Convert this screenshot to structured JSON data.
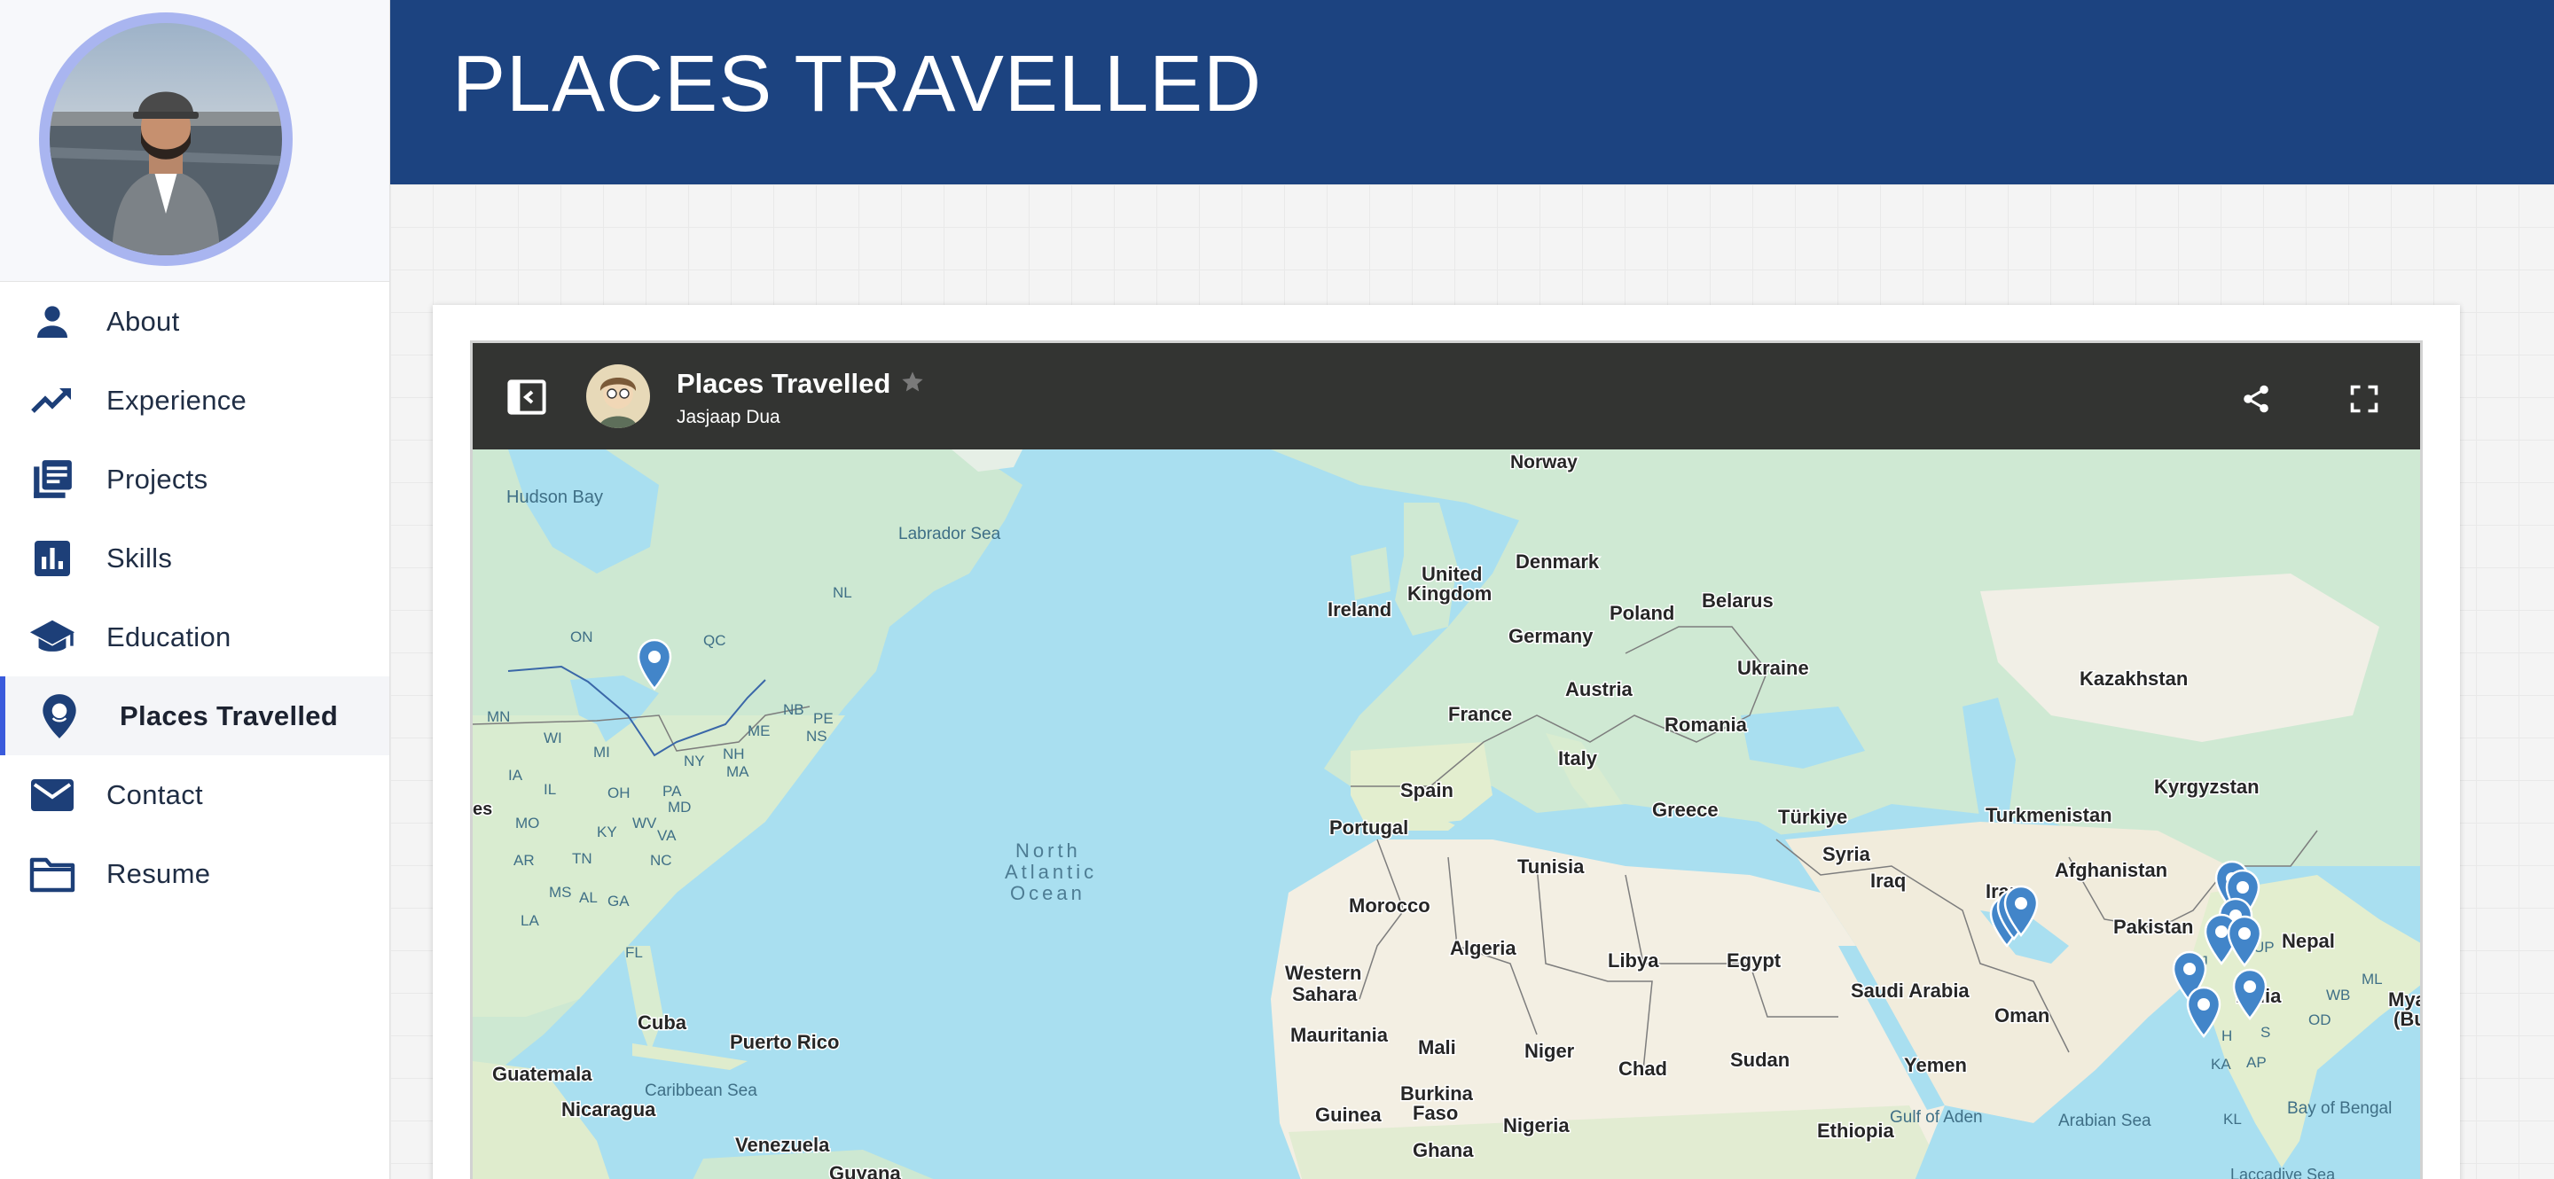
{
  "sidebar": {
    "items": [
      {
        "label": "About",
        "icon": "person-icon"
      },
      {
        "label": "Experience",
        "icon": "trending-up-icon"
      },
      {
        "label": "Projects",
        "icon": "article-icon"
      },
      {
        "label": "Skills",
        "icon": "bar-chart-icon"
      },
      {
        "label": "Education",
        "icon": "school-icon"
      },
      {
        "label": "Places Travelled",
        "icon": "map-pin-icon",
        "active": true
      },
      {
        "label": "Contact",
        "icon": "mail-icon"
      },
      {
        "label": "Resume",
        "icon": "folder-icon"
      }
    ]
  },
  "header": {
    "title": "PLACES TRAVELLED"
  },
  "map": {
    "title": "Places Travelled",
    "owner": "Jasjaap Dua",
    "labels": {
      "hudson_bay": "Hudson Bay",
      "labrador_sea": "Labrador Sea",
      "nl": "NL",
      "on": "ON",
      "qc": "QC",
      "mn": "MN",
      "wi": "WI",
      "mi": "MI",
      "me": "ME",
      "nb": "NB",
      "pe": "PE",
      "ns": "NS",
      "ia": "IA",
      "il": "IL",
      "oh": "OH",
      "ny": "NY",
      "nh": "NH",
      "ma": "MA",
      "pa": "PA",
      "md": "MD",
      "mo": "MO",
      "wv": "WV",
      "ky": "KY",
      "va": "VA",
      "ar": "AR",
      "tn": "TN",
      "nc": "NC",
      "ms": "MS",
      "al": "AL",
      "ga": "GA",
      "la": "LA",
      "fl": "FL",
      "es": "es",
      "north_atlantic": "North",
      "north_atlantic2": "Atlantic",
      "north_atlantic3": "Ocean",
      "norway": "Norway",
      "united": "United",
      "kingdom": "Kingdom",
      "denmark": "Denmark",
      "ireland": "Ireland",
      "belarus": "Belarus",
      "poland": "Poland",
      "germany": "Germany",
      "ukraine": "Ukraine",
      "austria": "Austria",
      "france": "France",
      "romania": "Romania",
      "italy": "Italy",
      "spain": "Spain",
      "portugal": "Portugal",
      "greece": "Greece",
      "turkiye": "Türkiye",
      "kazakhstan": "Kazakhstan",
      "kyrgyzstan": "Kyrgyzstan",
      "turkmenistan": "Turkmenistan",
      "tunisia": "Tunisia",
      "syria": "Syria",
      "iraq": "Iraq",
      "iran": "Iran",
      "afghanistan": "Afghanistan",
      "pakistan": "Pakistan",
      "nepal": "Nepal",
      "morocco": "Morocco",
      "algeria": "Algeria",
      "libya": "Libya",
      "egypt": "Egypt",
      "western": "Western",
      "sahara": "Sahara",
      "saudi_arabia": "Saudi Arabia",
      "oman": "Oman",
      "india": "India",
      "mauritania": "Mauritania",
      "mali": "Mali",
      "niger": "Niger",
      "chad": "Chad",
      "sudan": "Sudan",
      "yemen": "Yemen",
      "burkina": "Burkina",
      "faso": "Faso",
      "nigeria": "Nigeria",
      "guinea": "Guinea",
      "ghana": "Ghana",
      "ethiopia": "Ethiopia",
      "cuba": "Cuba",
      "puerto_rico": "Puerto Rico",
      "guatemala": "Guatemala",
      "nicaragua": "Nicaragua",
      "caribbean_sea": "Caribbean Sea",
      "venezuela": "Venezuela",
      "guyana": "Guyana",
      "gulf_of_aden": "Gulf of Aden",
      "arabian_sea": "Arabian Sea",
      "bay_of_bengal": "Bay of Bengal",
      "laccadive_sea": "Laccadive Sea",
      "rj": "RJ",
      "up": "UP",
      "wb": "WB",
      "ml": "ML",
      "od": "OD",
      "ap": "AP",
      "ka": "KA",
      "kl": "KL",
      "s": "S",
      "h": "H",
      "mya": "Mya",
      "bu": "(Bu"
    }
  },
  "colors": {
    "header": "#1c4380",
    "accent": "#3a5bdc",
    "pin": "#4285c9",
    "water": "#a9dff0",
    "land": "#cfe9d6"
  }
}
